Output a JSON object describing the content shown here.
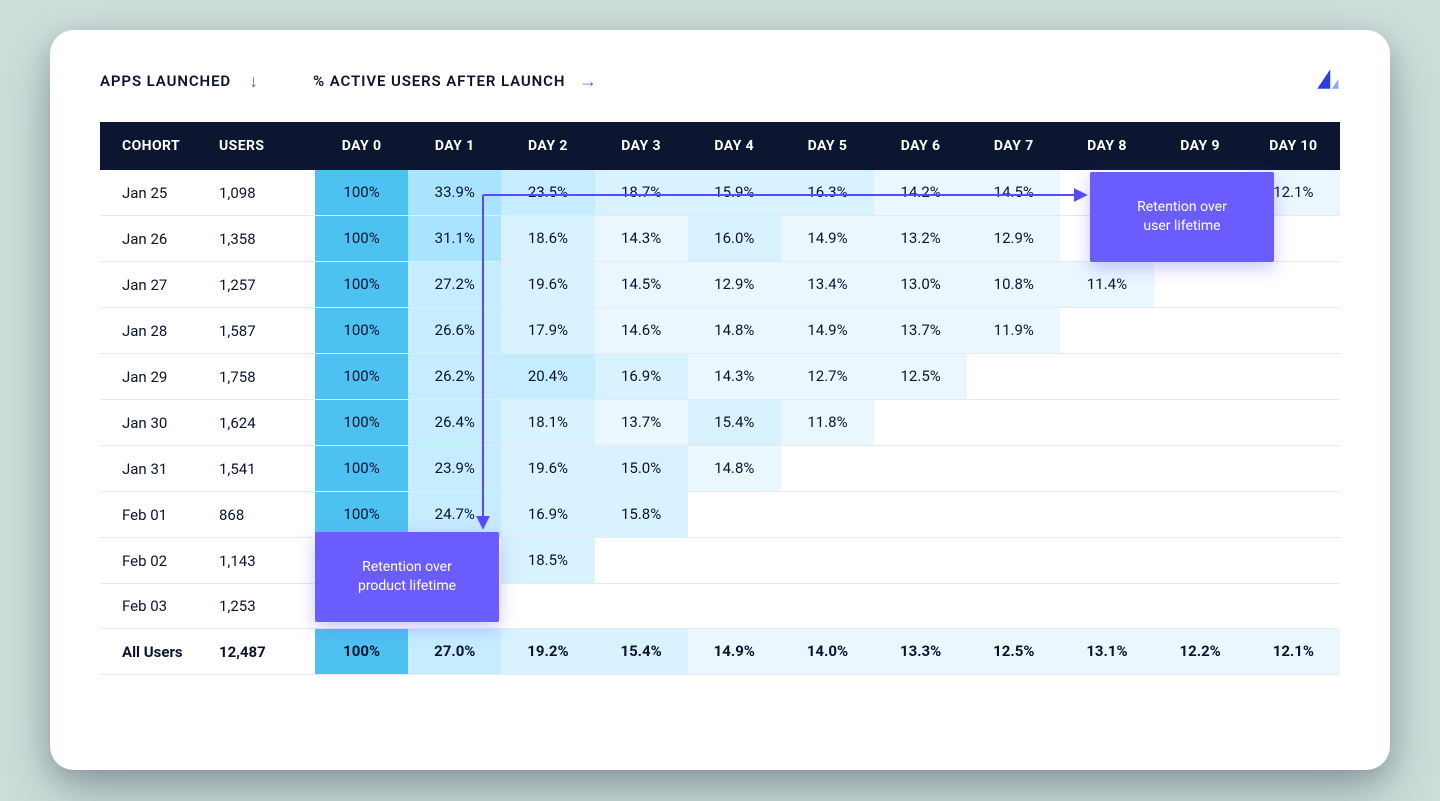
{
  "legend": {
    "apps_launched": "APPS LAUNCHED",
    "active_users": "% ACTIVE USERS AFTER LAUNCH"
  },
  "callouts": {
    "lifetime_user": "Retention over\nuser lifetime",
    "lifetime_product": "Retention over\nproduct lifetime"
  },
  "chart_data": {
    "type": "table",
    "title": "Cohort retention — % active users after launch",
    "headers": [
      "COHORT",
      "USERS",
      "DAY 0",
      "DAY 1",
      "DAY 2",
      "DAY 3",
      "DAY 4",
      "DAY 5",
      "DAY 6",
      "DAY 7",
      "DAY 8",
      "DAY 9",
      "DAY 10"
    ],
    "rows": [
      {
        "cohort": "Jan 25",
        "users": "1,098",
        "days": [
          "100%",
          "33.9%",
          "23.5%",
          "18.7%",
          "15.9%",
          "16.3%",
          "14.2%",
          "14.5%",
          "",
          "",
          "12.1%"
        ]
      },
      {
        "cohort": "Jan 26",
        "users": "1,358",
        "days": [
          "100%",
          "31.1%",
          "18.6%",
          "14.3%",
          "16.0%",
          "14.9%",
          "13.2%",
          "12.9%",
          "",
          "",
          ""
        ]
      },
      {
        "cohort": "Jan 27",
        "users": "1,257",
        "days": [
          "100%",
          "27.2%",
          "19.6%",
          "14.5%",
          "12.9%",
          "13.4%",
          "13.0%",
          "10.8%",
          "11.4%",
          "",
          ""
        ]
      },
      {
        "cohort": "Jan 28",
        "users": "1,587",
        "days": [
          "100%",
          "26.6%",
          "17.9%",
          "14.6%",
          "14.8%",
          "14.9%",
          "13.7%",
          "11.9%",
          "",
          "",
          ""
        ]
      },
      {
        "cohort": "Jan 29",
        "users": "1,758",
        "days": [
          "100%",
          "26.2%",
          "20.4%",
          "16.9%",
          "14.3%",
          "12.7%",
          "12.5%",
          "",
          "",
          "",
          ""
        ]
      },
      {
        "cohort": "Jan 30",
        "users": "1,624",
        "days": [
          "100%",
          "26.4%",
          "18.1%",
          "13.7%",
          "15.4%",
          "11.8%",
          "",
          "",
          "",
          "",
          ""
        ]
      },
      {
        "cohort": "Jan 31",
        "users": "1,541",
        "days": [
          "100%",
          "23.9%",
          "19.6%",
          "15.0%",
          "14.8%",
          "",
          "",
          "",
          "",
          "",
          ""
        ]
      },
      {
        "cohort": "Feb 01",
        "users": "868",
        "days": [
          "100%",
          "24.7%",
          "16.9%",
          "15.8%",
          "",
          "",
          "",
          "",
          "",
          "",
          ""
        ]
      },
      {
        "cohort": "Feb 02",
        "users": "1,143",
        "days": [
          "",
          "",
          "18.5%",
          "",
          "",
          "",
          "",
          "",
          "",
          "",
          ""
        ]
      },
      {
        "cohort": "Feb 03",
        "users": "1,253",
        "days": [
          "",
          "",
          "",
          "",
          "",
          "",
          "",
          "",
          "",
          "",
          ""
        ]
      }
    ],
    "summary": {
      "cohort": "All Users",
      "users": "12,487",
      "days": [
        "100%",
        "27.0%",
        "19.2%",
        "15.4%",
        "14.9%",
        "14.0%",
        "13.3%",
        "12.5%",
        "13.1%",
        "12.2%",
        "12.1%"
      ]
    },
    "heat_palette": {
      "day0": "#4dc1f0",
      "tiers": [
        {
          "min": 30,
          "color": "#a9e4ff"
        },
        {
          "min": 20,
          "color": "#c6ecff"
        },
        {
          "min": 15,
          "color": "#d9f2ff"
        },
        {
          "min": 0,
          "color": "#eaf7ff"
        }
      ]
    }
  }
}
